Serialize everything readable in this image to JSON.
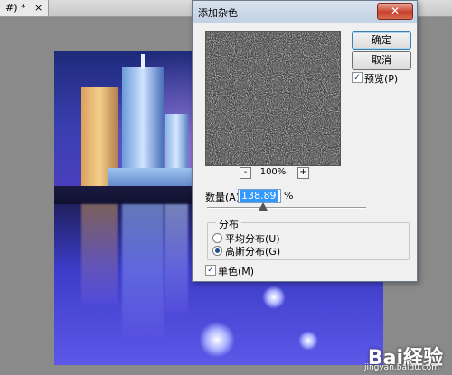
{
  "document_tab": {
    "label": "#) *",
    "close_glyph": "×"
  },
  "dialog": {
    "title": "添加杂色",
    "close_glyph": "✕",
    "buttons": {
      "ok": "确定",
      "cancel": "取消"
    },
    "preview": {
      "label": "预览(P)",
      "checked": true
    },
    "zoom": {
      "value": "100%",
      "minus": "-",
      "plus": "+"
    },
    "amount": {
      "label": "数量(A):",
      "value": "138.89",
      "unit": "%",
      "slider_fraction": 0.35
    },
    "distribution": {
      "title": "分布",
      "options": [
        {
          "label": "平均分布(U)",
          "selected": false
        },
        {
          "label": "高斯分布(G)",
          "selected": true
        }
      ]
    },
    "monochrome": {
      "label": "单色(M)",
      "checked": true
    }
  },
  "watermark": {
    "brand": "Bai経验",
    "url": "jingyan.baidu.com"
  }
}
